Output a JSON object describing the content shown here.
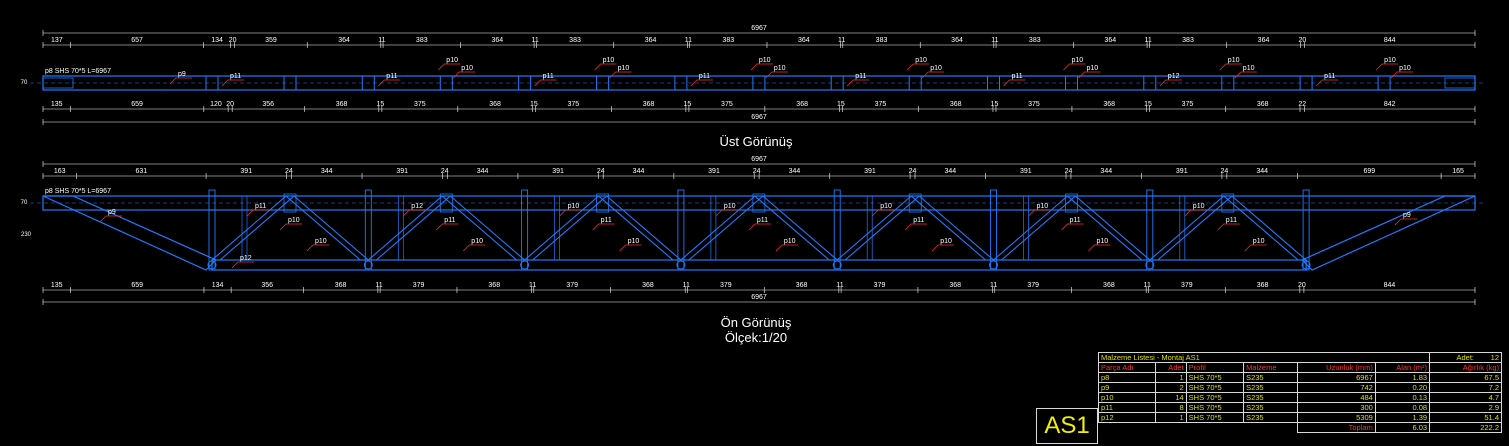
{
  "views": {
    "top_title": "Üst Görünüş",
    "front_title": "Ön Görünüş",
    "scale": "Ölçek:1/20"
  },
  "colors": {
    "member": "#1e7bff",
    "dim": "#ffffff",
    "leader": "#ff2a2a",
    "text_label": "#ffffff",
    "drawing_no": "#f0f000"
  },
  "top_view": {
    "overall": "6967",
    "top_dims": [
      "137",
      "657",
      "134",
      "20",
      "359",
      "364",
      "11",
      "383",
      "364",
      "11",
      "383",
      "364",
      "11",
      "383",
      "364",
      "11",
      "383",
      "364",
      "11",
      "383",
      "364",
      "11",
      "383",
      "364",
      "20",
      "844"
    ],
    "bottom_dims": [
      "135",
      "659",
      "120",
      "20",
      "356",
      "368",
      "15",
      "375",
      "368",
      "15",
      "375",
      "368",
      "15",
      "375",
      "368",
      "15",
      "375",
      "368",
      "15",
      "375",
      "368",
      "15",
      "375",
      "368",
      "22",
      "842"
    ],
    "member_label": "p8  SHS 70*5  L=6967",
    "height_dims": [
      "70",
      "10"
    ],
    "part_marks": [
      "p9",
      "p11",
      "p10",
      "p10",
      "p11",
      "p10",
      "p10",
      "p11",
      "p10",
      "p10",
      "p11",
      "p10",
      "p10",
      "p11",
      "p10",
      "p10",
      "p11",
      "p10",
      "p10",
      "p12",
      "p10",
      "p10",
      "p11",
      "p9"
    ]
  },
  "front_view": {
    "overall": "6967",
    "top_dims": [
      "163",
      "631",
      "391",
      "24",
      "344",
      "391",
      "24",
      "344",
      "391",
      "24",
      "344",
      "391",
      "24",
      "344",
      "391",
      "24",
      "344",
      "391",
      "24",
      "344",
      "391",
      "24",
      "344",
      "699",
      "165"
    ],
    "bottom_dims": [
      "135",
      "659",
      "134",
      "356",
      "368",
      "11",
      "379",
      "368",
      "11",
      "379",
      "368",
      "11",
      "379",
      "368",
      "11",
      "379",
      "368",
      "11",
      "379",
      "368",
      "11",
      "379",
      "368",
      "20",
      "844"
    ],
    "member_label": "p8  SHS 70*5  L=6967",
    "height_dims": [
      "230",
      "70",
      "10"
    ],
    "part_marks": [
      "p9",
      "p11",
      "p10",
      "p10",
      "p12",
      "p11",
      "p10",
      "p10",
      "p11",
      "p10",
      "p10",
      "p11",
      "p10",
      "p10",
      "p11",
      "p10",
      "p10",
      "p11",
      "p10",
      "p10",
      "p11",
      "p10",
      "p10",
      "p11",
      "p9"
    ]
  },
  "bom": {
    "title": "Malzeme Listesi - Montaj AS1",
    "adet_label": "Adet:",
    "adet_value": "12",
    "columns": [
      "Parça Adı",
      "Adet",
      "Profil",
      "Malzeme",
      "Uzunluk (mm)",
      "Alan (m²)",
      "Ağırlık (kg)"
    ],
    "rows": [
      [
        "p8",
        "1",
        "SHS 70*5",
        "S235",
        "6967",
        "1.83",
        "67.5"
      ],
      [
        "p9",
        "2",
        "SHS 70*5",
        "S235",
        "742",
        "0.20",
        "7.2"
      ],
      [
        "p10",
        "14",
        "SHS 70*5",
        "S235",
        "484",
        "0.13",
        "4.7"
      ],
      [
        "p11",
        "8",
        "SHS 70*5",
        "S235",
        "300",
        "0.08",
        "2.9"
      ],
      [
        "p12",
        "1",
        "SHS 70*5",
        "S235",
        "5309",
        "1.39",
        "51.4"
      ]
    ],
    "total_label": "Toplam",
    "total_area": "6.03",
    "total_weight": "222.2"
  },
  "drawing_no": "AS1"
}
